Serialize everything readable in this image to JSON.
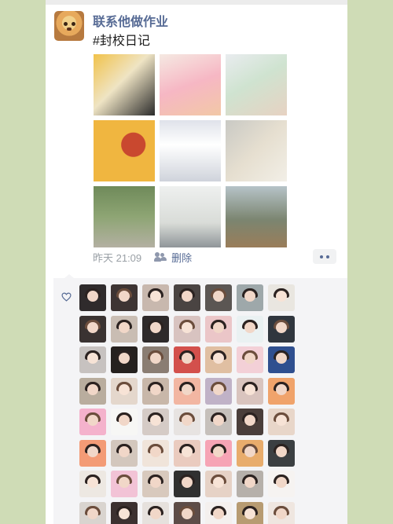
{
  "post": {
    "author": "联系他做作业",
    "text": "#封校日记",
    "time": "昨天 21:09",
    "delete_label": "删除"
  },
  "photo_icons": {
    "visibility": "people-icon",
    "actions": "more-dots-icon",
    "like": "heart-icon"
  },
  "photos": [
    {
      "bg": "linear-gradient(135deg,#f1c24a 0%,#efe4c4 45%,#2b2b2b 100%)",
      "text": ""
    },
    {
      "bg": "linear-gradient(160deg,#f5e9e2 0%,#f6b7c4 50%,#f2c8a6 100%)",
      "text": ""
    },
    {
      "bg": "linear-gradient(150deg,#e9ecef 0%,#cfe3d0 45%,#e7d2c2 100%)",
      "text": ""
    },
    {
      "bg": "radial-gradient(circle at 65% 40%,#c9482f 0 22%,#f0b640 23% 100%)",
      "text": ""
    },
    {
      "bg": "linear-gradient(180deg,#dfe2ea 0%,#ffffff 40%,#cfd3db 100%)",
      "text": ""
    },
    {
      "bg": "linear-gradient(135deg,#c9c9c4 0%,#e6dfd0 50%,#f2efe7 100%)",
      "text": ""
    },
    {
      "bg": "linear-gradient(180deg,#6f8a5a 0%,#8ea574 50%,#b3b0a2 100%)",
      "text": ""
    },
    {
      "bg": "linear-gradient(180deg,#eef0ef 0%,#d9dcd8 60%,#8f9599 100%)",
      "text": ""
    },
    {
      "bg": "linear-gradient(180deg,#b6c3c8 0%,#7b8570 55%,#9a7d5a 100%)",
      "text": ""
    }
  ],
  "like_avatars": [
    "#2f2b2c",
    "#3d3433",
    "#c8b8ae",
    "#4a4442",
    "#5b5653",
    "#9ea8aa",
    "#e9e6e0",
    "#3a3332",
    "#c9bdb3",
    "#2e2a2b",
    "#d8c3c0",
    "#ebc6c8",
    "#eaf1f2",
    "#30363e",
    "#c7c2c0",
    "#25211f",
    "#8a7d73",
    "#d3504c",
    "#e0bfa2",
    "#f3d0d7",
    "#2f4f8f",
    "#b9ad9e",
    "#e4d7cc",
    "#c8b7a9",
    "#f2b6a2",
    "#c0b2c7",
    "#d9c4be",
    "#f0a36b",
    "#f4b2cc",
    "#f7f7f5",
    "#d5cbc6",
    "#e7e3e1",
    "#c6c0bb",
    "#4a3e3a",
    "#e8d6c9",
    "#f39b76",
    "#d3c7bd",
    "#f0e4da",
    "#eacbbf",
    "#f6a4b5",
    "#e8ac6c",
    "#3b3f42",
    "#ede8e2",
    "#f2c3d6",
    "#d8c9bd",
    "#303030",
    "#e6d2c6",
    "#b6b0aa",
    "#f6f3f1",
    "#d9d4cf",
    "#3c3130",
    "#e6e1dd",
    "#5d4c48",
    "#f4f0ee",
    "#b79b72",
    "#efe6e0"
  ]
}
